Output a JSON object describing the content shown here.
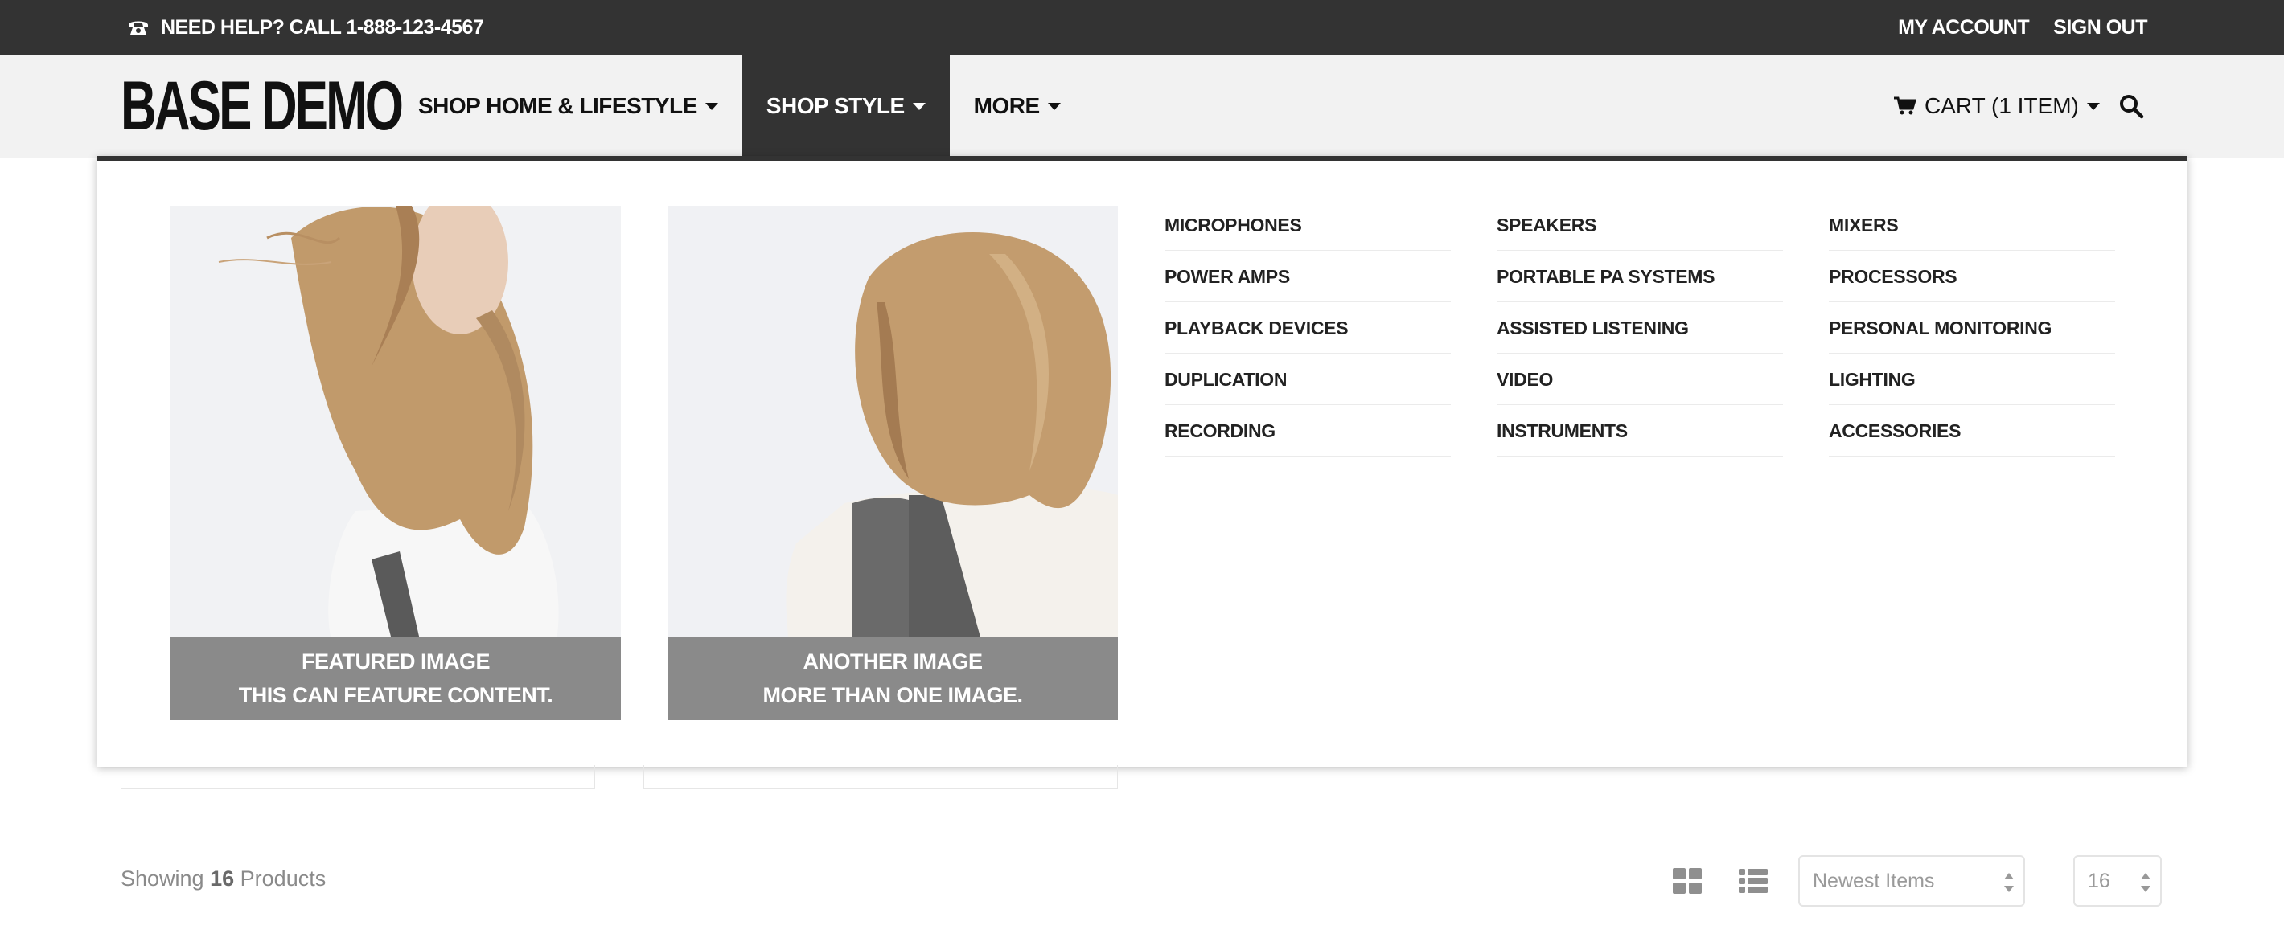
{
  "topbar": {
    "help_text": "NEED HELP? CALL 1-888-123-4567",
    "help_icon": "phone-icon",
    "links": [
      "MY ACCOUNT",
      "SIGN OUT"
    ]
  },
  "header": {
    "logo": "BASE DEMO",
    "nav": [
      {
        "label": "SHOP HOME & LIFESTYLE"
      },
      {
        "label": "SHOP STYLE"
      },
      {
        "label": "MORE"
      }
    ],
    "cart_label": "CART (1 ITEM)",
    "cart_icon": "cart-icon",
    "search_icon": "search-icon"
  },
  "mega_menu": {
    "promos": [
      {
        "line1": "FEATURED IMAGE",
        "line2": "THIS CAN FEATURE CONTENT."
      },
      {
        "line1": "ANOTHER IMAGE",
        "line2": "MORE THAN ONE IMAGE."
      }
    ],
    "columns": [
      [
        "MICROPHONES",
        "POWER AMPS",
        "PLAYBACK DEVICES",
        "DUPLICATION",
        "RECORDING"
      ],
      [
        "SPEAKERS",
        "PORTABLE PA SYSTEMS",
        "ASSISTED LISTENING",
        "VIDEO",
        "INSTRUMENTS"
      ],
      [
        "MIXERS",
        "PROCESSORS",
        "PERSONAL MONITORING",
        "LIGHTING",
        "ACCESSORIES"
      ]
    ]
  },
  "toolbar": {
    "showing_prefix": "Showing",
    "count": "16",
    "showing_suffix": "Products",
    "sort_value": "Newest Items",
    "per_page_value": "16",
    "grid_icon": "grid-view-icon",
    "list_icon": "list-view-icon"
  },
  "colors": {
    "topbar_bg": "#333333",
    "header_bg": "#f2f2f2",
    "caption_bg": "#8a8a8a"
  }
}
